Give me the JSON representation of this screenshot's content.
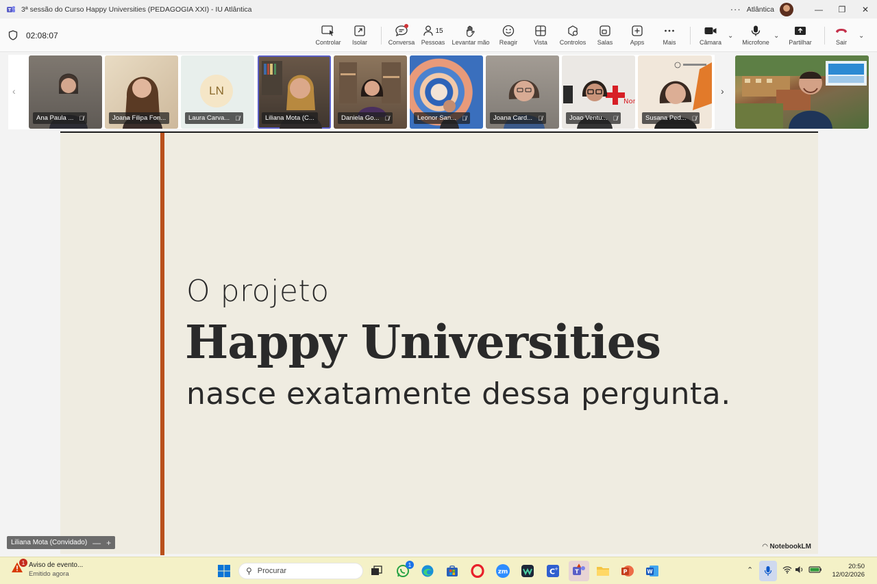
{
  "window": {
    "title": "3ª sessão do Curso Happy Universities (PEDAGOGIA XXI) - IU Atlântica",
    "org": "Atlântica",
    "more": "···"
  },
  "meeting": {
    "timer": "02:08:07",
    "toolbar": [
      {
        "id": "controlar",
        "label": "Controlar",
        "icon": "cursor-screen-icon"
      },
      {
        "id": "isolar",
        "label": "Isolar",
        "icon": "popout-icon"
      },
      {
        "id": "conversa",
        "label": "Conversa",
        "icon": "chat-icon"
      },
      {
        "id": "pessoas",
        "label": "Pessoas",
        "icon": "people-icon",
        "count": "15"
      },
      {
        "id": "levantar",
        "label": "Levantar mão",
        "icon": "hand-icon"
      },
      {
        "id": "reagir",
        "label": "Reagir",
        "icon": "smiley-icon"
      },
      {
        "id": "vista",
        "label": "Vista",
        "icon": "grid-icon"
      },
      {
        "id": "controlos",
        "label": "Controlos",
        "icon": "controls-icon"
      },
      {
        "id": "salas",
        "label": "Salas",
        "icon": "rooms-icon"
      },
      {
        "id": "apps",
        "label": "Apps",
        "icon": "plus-icon"
      },
      {
        "id": "mais",
        "label": "Mais",
        "icon": "more-icon"
      },
      {
        "id": "camara",
        "label": "Câmara",
        "icon": "camera-icon"
      },
      {
        "id": "microfone",
        "label": "Microfone",
        "icon": "mic-icon"
      },
      {
        "id": "partilhar",
        "label": "Partilhar",
        "icon": "share-icon"
      },
      {
        "id": "sair",
        "label": "Sair",
        "icon": "hangup-icon"
      }
    ]
  },
  "participants": [
    {
      "name": "Ana Paula ...",
      "bg": "#6f6a64"
    },
    {
      "name": "Joana Filipa Fon...",
      "bg": "#d9c7ad"
    },
    {
      "name": "Laura Carva...",
      "bg": "#e6eeea",
      "initials": "LN"
    },
    {
      "name": "Liliana Mota (C...",
      "bg": "#5a4a3a",
      "active": true
    },
    {
      "name": "Daniela Go...",
      "bg": "#7a6450"
    },
    {
      "name": "Leonor San...",
      "bg": "#4b78b8"
    },
    {
      "name": "Joana Card...",
      "bg": "#8f8a84"
    },
    {
      "name": "Joao Ventu...",
      "bg": "#e9e6e3"
    },
    {
      "name": "Susana Ped...",
      "bg": "#efe4d6"
    }
  ],
  "slide": {
    "line1": "O projeto",
    "line2": "Happy Universities",
    "line3": "nasce exatamente dessa pergunta.",
    "brand": "NotebookLM",
    "accent": "#b9501c",
    "background": "#efece1"
  },
  "presenter": {
    "label": "Liliana Mota (Convidado)"
  },
  "taskbar": {
    "notification_title": "Aviso de evento...",
    "notification_sub": "Emitido agora",
    "notification_badge": "1",
    "search_placeholder": "Procurar",
    "whatsapp_badge": "1",
    "time": "20:50",
    "date": "12/02/2026"
  }
}
